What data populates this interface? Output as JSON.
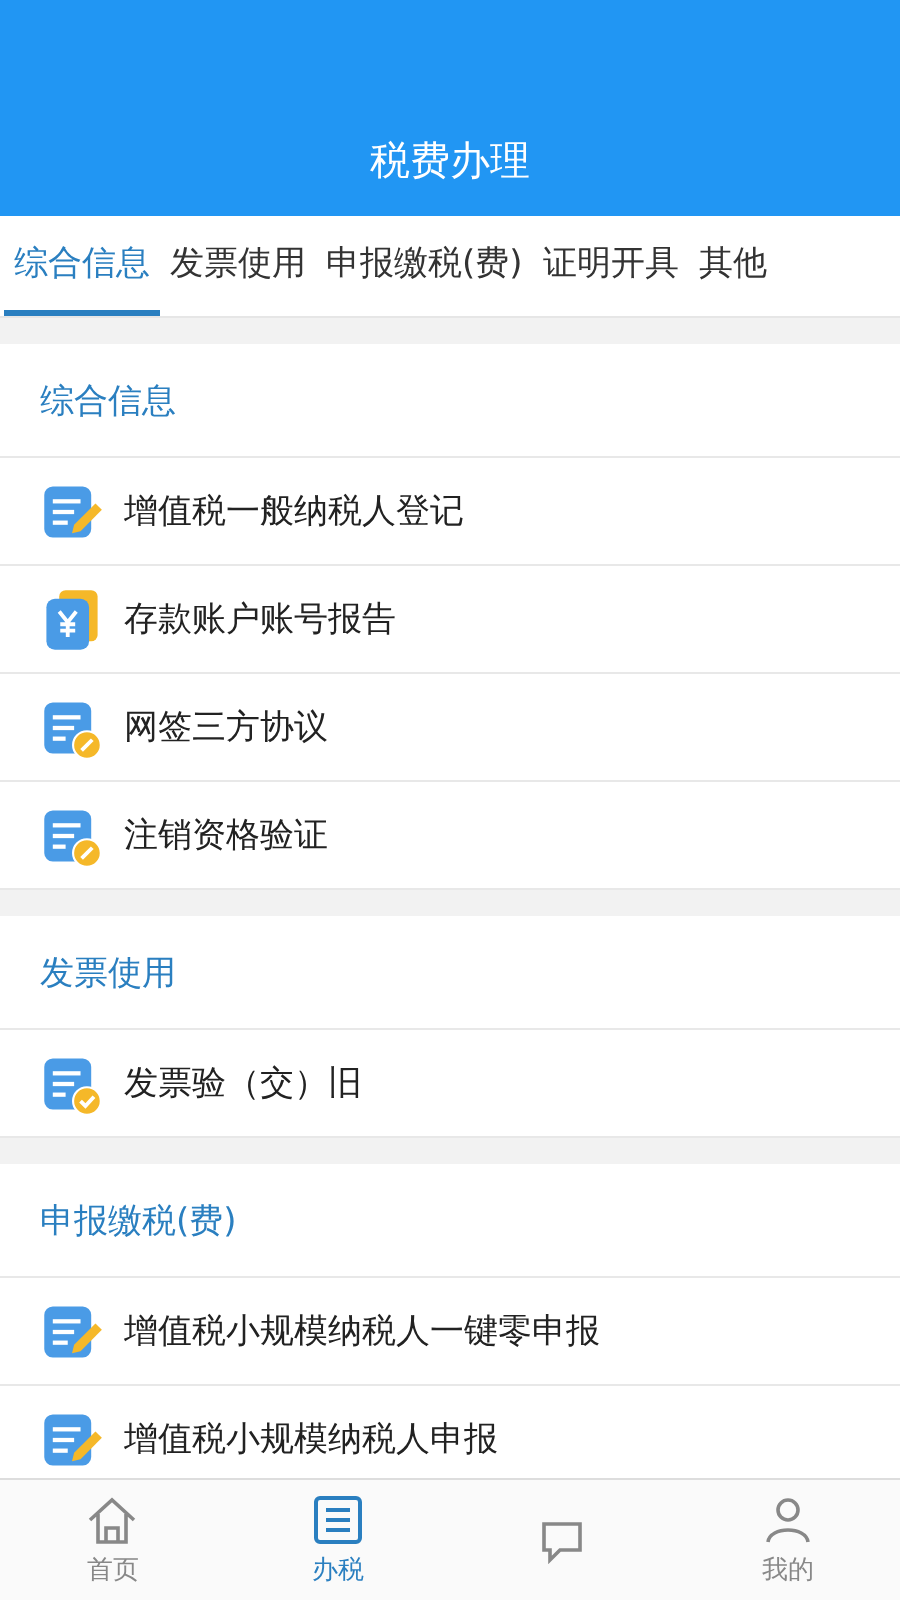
{
  "header": {
    "title": "税费办理"
  },
  "tabs": [
    {
      "label": "综合信息",
      "selected": true
    },
    {
      "label": "发票使用",
      "selected": false
    },
    {
      "label": "申报缴税(费)",
      "selected": false
    },
    {
      "label": "证明开具",
      "selected": false
    },
    {
      "label": "其他",
      "selected": false
    }
  ],
  "sections": [
    {
      "title": "综合信息",
      "items": [
        {
          "label": "增值税一般纳税人登记",
          "kind": "edit"
        },
        {
          "label": "存款账户账号报告",
          "kind": "money"
        },
        {
          "label": "网签三方协议",
          "kind": "link"
        },
        {
          "label": "注销资格验证",
          "kind": "link"
        }
      ]
    },
    {
      "title": "发票使用",
      "items": [
        {
          "label": "发票验（交）旧",
          "kind": "check"
        }
      ]
    },
    {
      "title": "申报缴税(费)",
      "items": [
        {
          "label": "增值税小规模纳税人一键零申报",
          "kind": "edit"
        },
        {
          "label": "增值税小规模纳税人申报",
          "kind": "edit"
        }
      ]
    }
  ],
  "nav": [
    {
      "label": "首页",
      "kind": "home",
      "selected": false
    },
    {
      "label": "办税",
      "kind": "list",
      "selected": true
    },
    {
      "kind": "chat",
      "selected": false
    },
    {
      "label": "我的",
      "kind": "user",
      "selected": false
    }
  ]
}
